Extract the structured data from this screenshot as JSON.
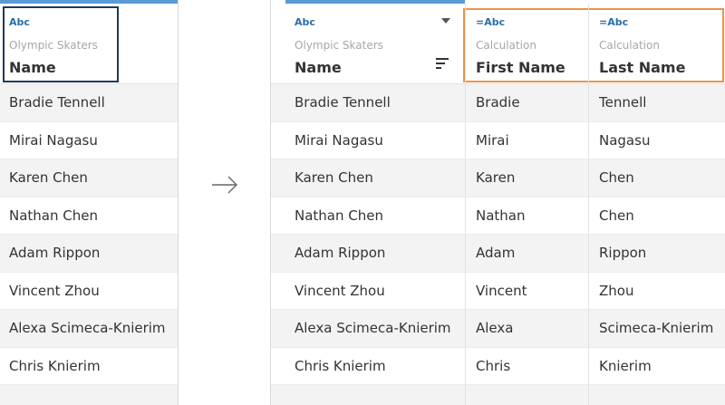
{
  "left_table": {
    "column": {
      "type_label": "Abc",
      "source": "Olympic Skaters",
      "field": "Name"
    },
    "rows": [
      "Bradie Tennell",
      "Mirai Nagasu",
      "Karen Chen",
      "Nathan Chen",
      "Adam Rippon",
      "Vincent Zhou",
      "Alexa Scimeca-Knierim",
      "Chris Knierim"
    ]
  },
  "right_table": {
    "columns": [
      {
        "type_label": "Abc",
        "source": "Olympic Skaters",
        "field": "Name"
      },
      {
        "type_label": "=Abc",
        "source": "Calculation",
        "field": "First Name"
      },
      {
        "type_label": "=Abc",
        "source": "Calculation",
        "field": "Last Name"
      }
    ],
    "rows": [
      [
        "Bradie Tennell",
        "Bradie",
        "Tennell"
      ],
      [
        "Mirai Nagasu",
        "Mirai",
        "Nagasu"
      ],
      [
        "Karen Chen",
        "Karen",
        "Chen"
      ],
      [
        "Nathan Chen",
        "Nathan",
        "Chen"
      ],
      [
        "Adam Rippon",
        "Adam",
        "Rippon"
      ],
      [
        "Vincent Zhou",
        "Vincent",
        "Zhou"
      ],
      [
        "Alexa Scimeca-Knierim",
        "Alexa",
        "Scimeca-Knierim"
      ],
      [
        "Chris Knierim",
        "Chris",
        "Knierim"
      ]
    ]
  },
  "colors": {
    "selection_dark": "#1f3a5a",
    "selection_orange": "#e8954c",
    "type_blue": "#2a6ea6",
    "top_bar": "#5b9bd5"
  },
  "icons": {
    "arrow": "right-arrow-icon",
    "sort": "sort-icon",
    "dropdown": "chevron-down-icon"
  }
}
